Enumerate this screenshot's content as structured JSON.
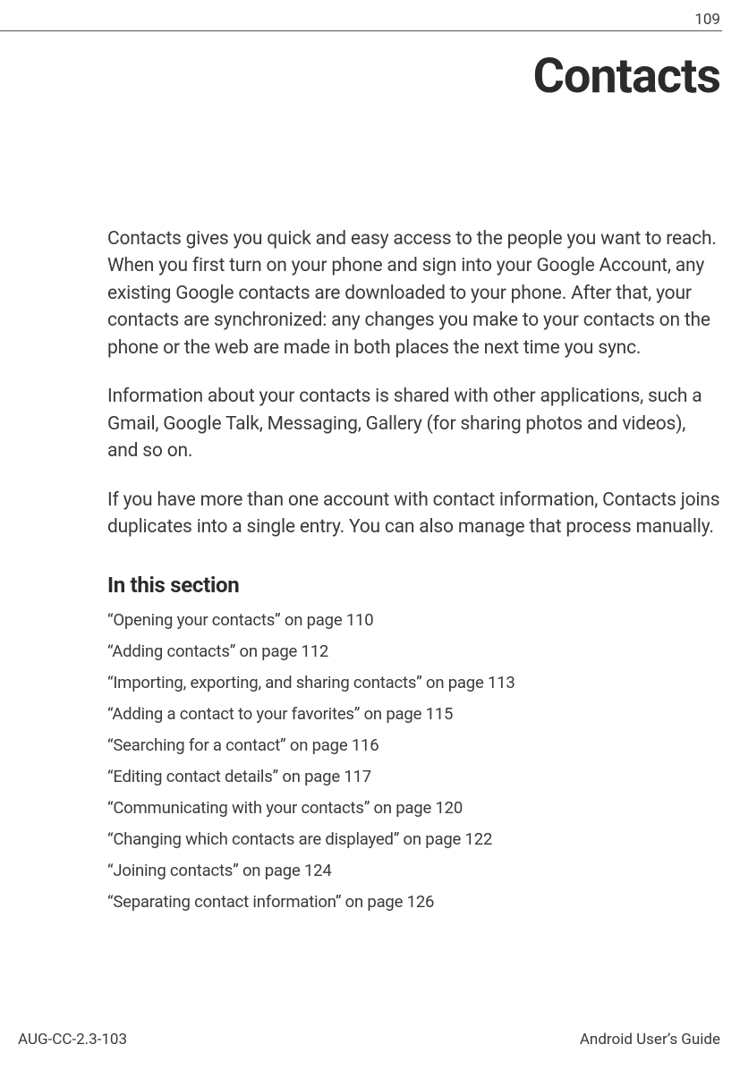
{
  "header": {
    "page_number": "109"
  },
  "chapter": {
    "title": "Contacts"
  },
  "intro": {
    "p1": "Contacts gives you quick and easy access to the people you want to reach. When you first turn on your phone and sign into your Google Account, any existing Google contacts are downloaded to your phone. After that, your contacts are synchronized: any changes you make to your contacts on the phone or the web are made in both places the next time you sync.",
    "p2": "Information about your contacts is shared with other applications, such a Gmail, Google Talk, Messaging, Gallery (for sharing photos and videos), and so on.",
    "p3": "If you have more than one account with contact information, Contacts joins duplicates into a single entry. You can also manage that process manually."
  },
  "section": {
    "heading": "In this section",
    "entries": [
      "“Opening your contacts” on page 110",
      "“Adding contacts” on page 112",
      "“Importing, exporting, and sharing contacts” on page 113",
      "“Adding a contact to your favorites” on page 115",
      "“Searching for a contact” on page 116",
      "“Editing contact details” on page 117",
      "“Communicating with your contacts” on page 120",
      "“Changing which contacts are displayed” on page 122",
      "“Joining contacts” on page 124",
      "“Separating contact information” on page 126"
    ]
  },
  "footer": {
    "left": "AUG-CC-2.3-103",
    "right": "Android User’s Guide"
  }
}
